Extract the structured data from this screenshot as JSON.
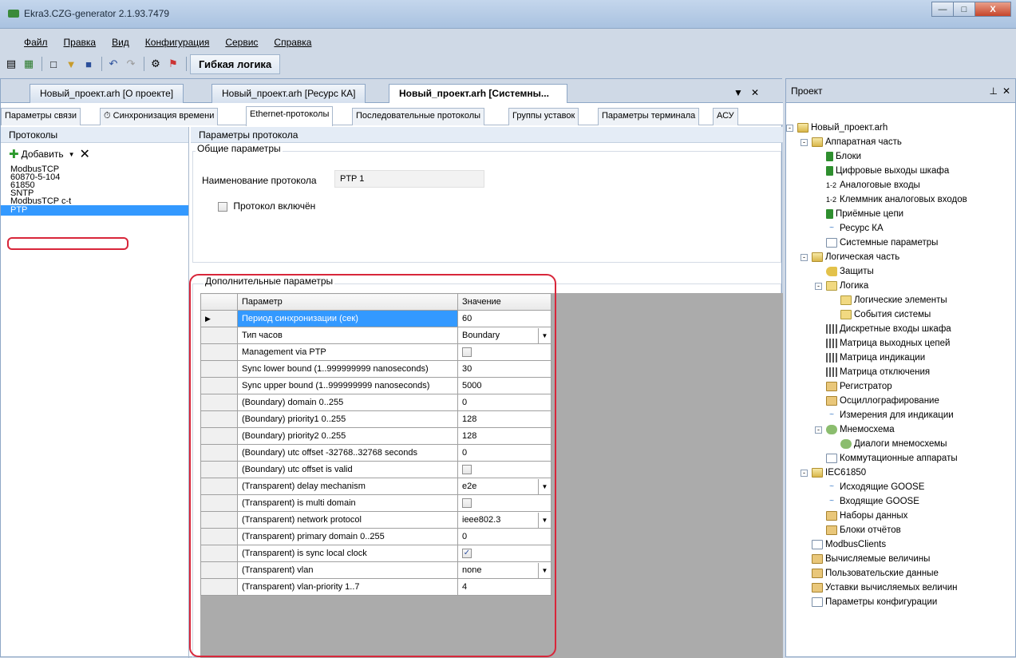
{
  "window": {
    "title": "Ekra3.CZG-generator 2.1.93.7479"
  },
  "menu": [
    "Файл",
    "Правка",
    "Вид",
    "Конфигурация",
    "Сервис",
    "Справка"
  ],
  "toolbar": {
    "label": "Гибкая логика"
  },
  "doc_tabs": [
    {
      "label": "Новый_проект.arh [О проекте]",
      "active": false
    },
    {
      "label": "Новый_проект.arh [Ресурс КА]",
      "active": false
    },
    {
      "label": "Новый_проект.arh [Системны...",
      "active": true
    }
  ],
  "sub_tabs": [
    {
      "label": "Параметры связи",
      "active": false
    },
    {
      "label": "Синхронизация времени",
      "active": false
    },
    {
      "label": "Ethernet-протоколы",
      "active": true
    },
    {
      "label": "Последовательные протоколы",
      "active": false
    },
    {
      "label": "Группы уставок",
      "active": false
    },
    {
      "label": "Параметры терминала",
      "active": false
    },
    {
      "label": "АСУ",
      "active": false
    }
  ],
  "protocols": {
    "header": "Протоколы",
    "add_label": "Добавить",
    "items": [
      "ModbusTCP",
      "60870-5-104",
      "61850",
      "SNTP",
      "ModbusTCP c-t",
      "PTP"
    ],
    "selected": "PTP"
  },
  "params": {
    "header": "Параметры протокола",
    "general_group": "Общие параметры",
    "name_label": "Наименование протокола",
    "name_value": "PTP 1",
    "enabled_label": "Протокол включён",
    "enabled": false,
    "extra_group": "Дополнительные параметры",
    "grid_header_param": "Параметр",
    "grid_header_value": "Значение",
    "rows": [
      {
        "name": "Период синхронизации (сек)",
        "value": "60",
        "kind": "text"
      },
      {
        "name": "Тип часов",
        "value": "Boundary",
        "kind": "combo"
      },
      {
        "name": "Management via PTP",
        "value": "",
        "kind": "check",
        "checked": false
      },
      {
        "name": "Sync lower bound (1..999999999 nanoseconds)",
        "value": "30",
        "kind": "text"
      },
      {
        "name": "Sync upper bound (1..999999999 nanoseconds)",
        "value": "5000",
        "kind": "text"
      },
      {
        "name": "(Boundary) domain 0..255",
        "value": "0",
        "kind": "text"
      },
      {
        "name": "(Boundary) priority1 0..255",
        "value": "128",
        "kind": "text"
      },
      {
        "name": "(Boundary) priority2 0..255",
        "value": "128",
        "kind": "text"
      },
      {
        "name": "(Boundary) utc offset -32768..32768 seconds",
        "value": "0",
        "kind": "text"
      },
      {
        "name": "(Boundary) utc offset is valid",
        "value": "",
        "kind": "check",
        "checked": false
      },
      {
        "name": "(Transparent) delay mechanism",
        "value": "e2e",
        "kind": "combo"
      },
      {
        "name": "(Transparent) is multi domain",
        "value": "",
        "kind": "check",
        "checked": false
      },
      {
        "name": "(Transparent) network protocol",
        "value": "ieee802.3",
        "kind": "combo"
      },
      {
        "name": "(Transparent) primary domain 0..255",
        "value": "0",
        "kind": "text"
      },
      {
        "name": "(Transparent) is sync local clock",
        "value": "",
        "kind": "check",
        "checked": true
      },
      {
        "name": "(Transparent) vlan",
        "value": "none",
        "kind": "combo"
      },
      {
        "name": "(Transparent) vlan-priority 1..7",
        "value": "4",
        "kind": "text"
      }
    ]
  },
  "project": {
    "header": "Проект",
    "tree": [
      {
        "label": "Новый_проект.arh",
        "level": 0,
        "icon": "folder",
        "exp": "-"
      },
      {
        "label": "Аппаратная часть",
        "level": 1,
        "icon": "folder",
        "exp": "-"
      },
      {
        "label": "Блоки",
        "level": 2,
        "icon": "green"
      },
      {
        "label": "Цифровые выходы шкафа",
        "level": 2,
        "icon": "green"
      },
      {
        "label": "Аналоговые входы",
        "level": 2,
        "icon": "num"
      },
      {
        "label": "Клеммник аналоговых входов",
        "level": 2,
        "icon": "num"
      },
      {
        "label": "Приёмные цепи",
        "level": 2,
        "icon": "green"
      },
      {
        "label": "Ресурс КА",
        "level": 2,
        "icon": "wave"
      },
      {
        "label": "Системные параметры",
        "level": 2,
        "icon": "doc"
      },
      {
        "label": "Логическая часть",
        "level": 1,
        "icon": "folder",
        "exp": "-"
      },
      {
        "label": "Защиты",
        "level": 2,
        "icon": "key"
      },
      {
        "label": "Логика",
        "level": 2,
        "icon": "yellow",
        "exp": "-"
      },
      {
        "label": "Логические элементы",
        "level": 3,
        "icon": "yellow"
      },
      {
        "label": "События системы",
        "level": 3,
        "icon": "yellow"
      },
      {
        "label": "Дискретные входы шкафа",
        "level": 2,
        "icon": "grid"
      },
      {
        "label": "Матрица выходных цепей",
        "level": 2,
        "icon": "grid"
      },
      {
        "label": "Матрица индикации",
        "level": 2,
        "icon": "grid"
      },
      {
        "label": "Матрица отключения",
        "level": 2,
        "icon": "grid"
      },
      {
        "label": "Регистратор",
        "level": 2,
        "icon": "chart"
      },
      {
        "label": "Осциллографирование",
        "level": 2,
        "icon": "chart"
      },
      {
        "label": "Измерения для индикации",
        "level": 2,
        "icon": "wave"
      },
      {
        "label": "Мнемосхема",
        "level": 2,
        "icon": "plant",
        "exp": "-"
      },
      {
        "label": "Диалоги мнемосхемы",
        "level": 3,
        "icon": "plant"
      },
      {
        "label": "Коммутационные аппараты",
        "level": 2,
        "icon": "doc"
      },
      {
        "label": "IEC61850",
        "level": 1,
        "icon": "folder",
        "exp": "-"
      },
      {
        "label": "Исходящие GOOSE",
        "level": 2,
        "icon": "wave"
      },
      {
        "label": "Входящие GOOSE",
        "level": 2,
        "icon": "wave"
      },
      {
        "label": "Наборы данных",
        "level": 2,
        "icon": "chart"
      },
      {
        "label": "Блоки отчётов",
        "level": 2,
        "icon": "chart"
      },
      {
        "label": "ModbusClients",
        "level": 1,
        "icon": "doc"
      },
      {
        "label": "Вычисляемые величины",
        "level": 1,
        "icon": "chart"
      },
      {
        "label": "Пользовательские данные",
        "level": 1,
        "icon": "chart"
      },
      {
        "label": "Уставки вычисляемых величин",
        "level": 1,
        "icon": "chart"
      },
      {
        "label": "Параметры конфигурации",
        "level": 1,
        "icon": "doc"
      }
    ]
  },
  "colors": {
    "selection": "#3399ff",
    "highlight": "#d8263a"
  }
}
